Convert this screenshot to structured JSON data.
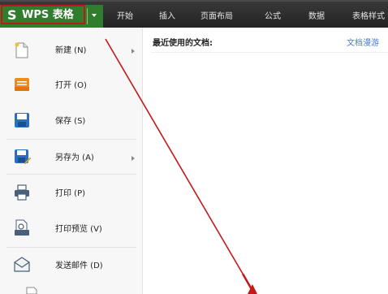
{
  "app": {
    "logo": "S",
    "title": "WPS 表格"
  },
  "menu_tabs": [
    "开始",
    "插入",
    "页面布局",
    "公式",
    "数据",
    "表格样式"
  ],
  "file_menu": {
    "items": [
      {
        "label": "新建 (N)",
        "icon": "new-document-icon",
        "has_submenu": true
      },
      {
        "label": "打开 (O)",
        "icon": "open-folder-icon",
        "has_submenu": false
      },
      {
        "label": "保存 (S)",
        "icon": "save-disk-icon",
        "has_submenu": false
      },
      {
        "label": "另存为 (A)",
        "icon": "save-as-icon",
        "has_submenu": true
      },
      {
        "label": "打印 (P)",
        "icon": "printer-icon",
        "has_submenu": false
      },
      {
        "label": "打印预览 (V)",
        "icon": "print-preview-icon",
        "has_submenu": false
      },
      {
        "label": "发送邮件 (D)",
        "icon": "send-mail-icon",
        "has_submenu": false
      }
    ]
  },
  "recent": {
    "title": "最近使用的文档:",
    "link": "文档漫游"
  },
  "colors": {
    "app_button": "#2f7d2d",
    "menubar": "#2b2b2b",
    "annotation": "#c41818",
    "link": "#4a7bd0"
  }
}
